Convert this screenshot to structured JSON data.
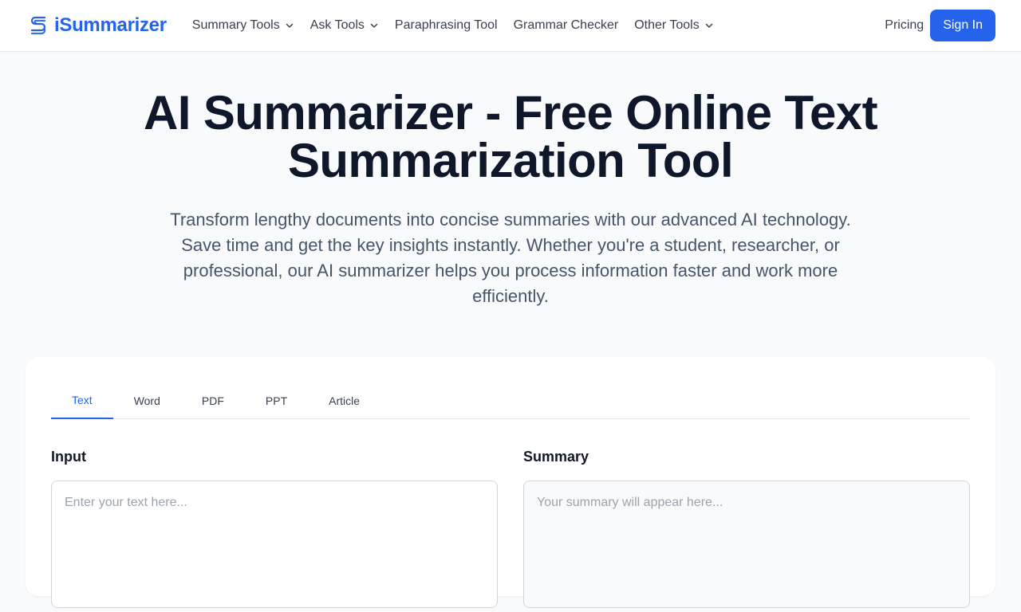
{
  "brand": {
    "name": "iSummarizer",
    "color": "#2563eb"
  },
  "nav": {
    "items": [
      {
        "label": "Summary Tools",
        "has_dropdown": true
      },
      {
        "label": "Ask Tools",
        "has_dropdown": true
      },
      {
        "label": "Paraphrasing Tool",
        "has_dropdown": false
      },
      {
        "label": "Grammar Checker",
        "has_dropdown": false
      },
      {
        "label": "Other Tools",
        "has_dropdown": true
      }
    ],
    "pricing_label": "Pricing",
    "signin_label": "Sign In"
  },
  "hero": {
    "title": "AI Summarizer - Free Online Text Summarization Tool",
    "subtitle": "Transform lengthy documents into concise summaries with our advanced AI technology. Save time and get the key insights instantly. Whether you're a student, researcher, or professional, our AI summarizer helps you process information faster and work more efficiently."
  },
  "tool": {
    "tabs": [
      {
        "label": "Text",
        "active": true
      },
      {
        "label": "Word",
        "active": false
      },
      {
        "label": "PDF",
        "active": false
      },
      {
        "label": "PPT",
        "active": false
      },
      {
        "label": "Article",
        "active": false
      }
    ],
    "input": {
      "label": "Input",
      "placeholder": "Enter your text here...",
      "value": ""
    },
    "summary": {
      "label": "Summary",
      "placeholder": "Your summary will appear here..."
    }
  },
  "icons": {
    "logo": "brand-logo-icon",
    "dropdown": "chevron-down-icon"
  },
  "colors": {
    "accent": "#2563eb",
    "text_primary": "#0f172a",
    "text_secondary": "#475569",
    "page_bg": "#f8fafc"
  }
}
